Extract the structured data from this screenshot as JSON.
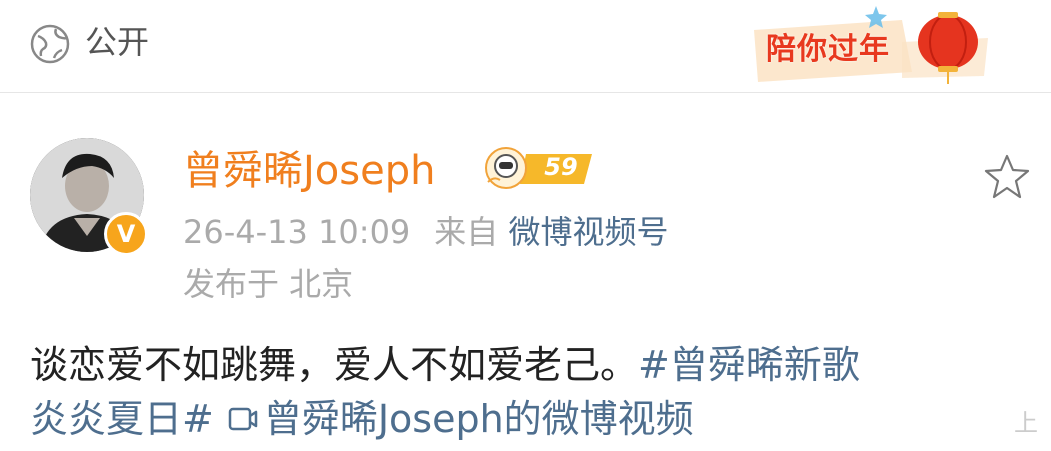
{
  "visibility": {
    "label": "公开",
    "icon": "globe-icon"
  },
  "banner": {
    "text": "陪你过年",
    "icon": "lantern-icon"
  },
  "post": {
    "author": "曾舜晞Joseph",
    "level": "59",
    "verified_badge": "V",
    "time": "26-4-13 10:09",
    "source_prefix": "来自",
    "source": "微博视频号",
    "location": "发布于 北京",
    "text_line1": "谈恋爱不如跳舞，爱人不如爱老己。",
    "hashtag_part1": "#曾舜晞新歌",
    "hashtag_part2": "炎炎夏日#",
    "video_link": "曾舜晞Joseph的微博视频",
    "expand_label": "上"
  },
  "colors": {
    "accent_orange": "#f07f1e",
    "link_blue": "#4e6e8e",
    "meta_gray": "#aaaaaa",
    "badge_gold": "#f7a51c"
  }
}
